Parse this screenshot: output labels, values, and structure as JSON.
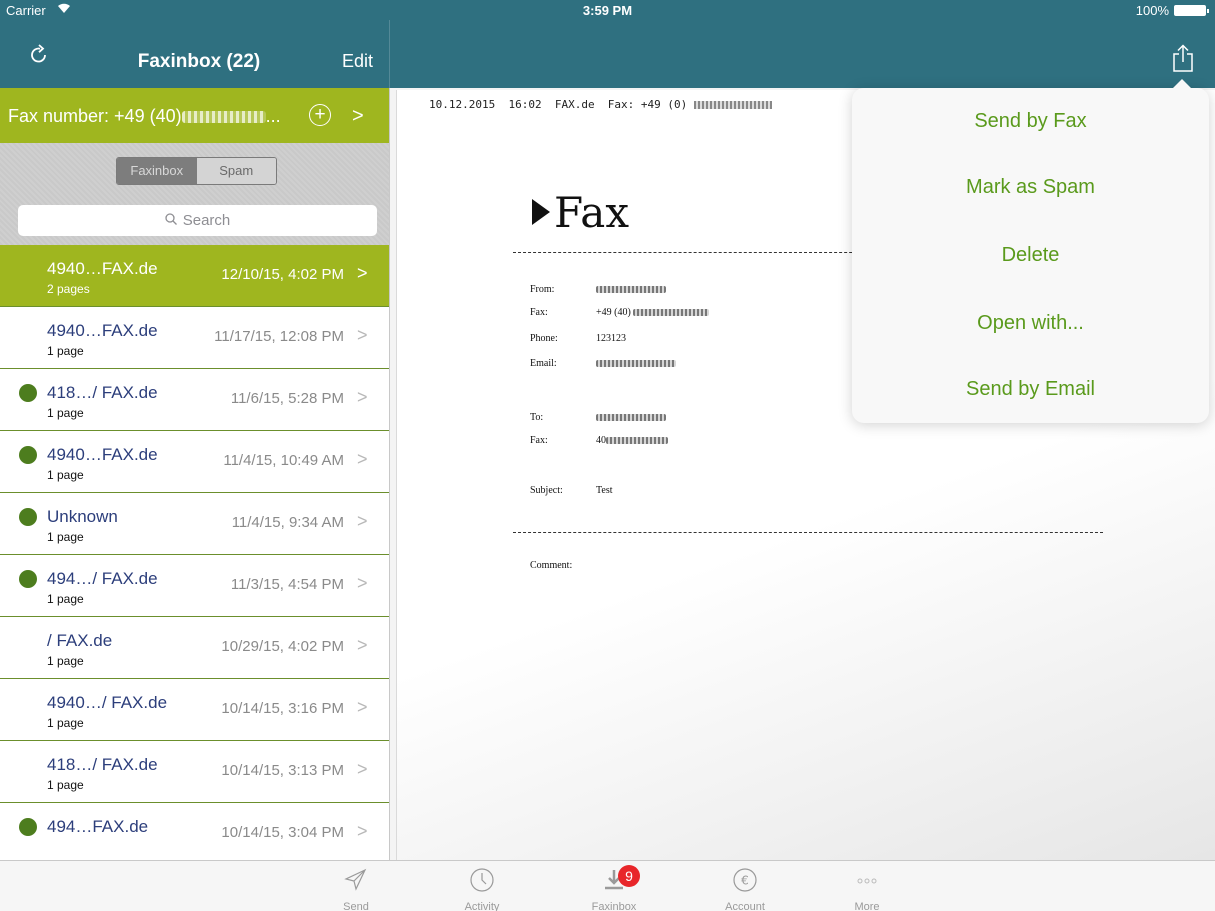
{
  "status_bar": {
    "carrier": "Carrier",
    "time": "3:59 PM",
    "battery": "100%"
  },
  "navbar": {
    "title": "Faxinbox (22)",
    "edit_label": "Edit"
  },
  "fax_number_bar": {
    "label": "Fax number: +49 (40)",
    "suffix": "...",
    "arrow": ">"
  },
  "segments": {
    "active": "Faxinbox",
    "inactive": "Spam"
  },
  "search": {
    "placeholder": "Search"
  },
  "faxes": [
    {
      "name": "4940…FAX.de",
      "pages": "2 pages",
      "date": "12/10/15, 4:02 PM"
    },
    {
      "name": "4940…FAX.de",
      "pages": "1 page",
      "date": "11/17/15, 12:08 PM"
    },
    {
      "name": "418…/ FAX.de",
      "pages": "1 page",
      "date": "11/6/15, 5:28 PM"
    },
    {
      "name": "4940…FAX.de",
      "pages": "1 page",
      "date": "11/4/15, 10:49 AM"
    },
    {
      "name": "Unknown",
      "pages": "1 page",
      "date": "11/4/15, 9:34 AM"
    },
    {
      "name": "494…/ FAX.de",
      "pages": "1 page",
      "date": "11/3/15, 4:54 PM"
    },
    {
      "name": "/ FAX.de",
      "pages": "1 page",
      "date": "10/29/15, 4:02 PM"
    },
    {
      "name": "4940…/ FAX.de",
      "pages": "1 page",
      "date": "10/14/15, 3:16 PM"
    },
    {
      "name": "418…/ FAX.de",
      "pages": "1 page",
      "date": "10/14/15, 3:13 PM"
    },
    {
      "name": "494…FAX.de",
      "pages": "",
      "date": "10/14/15, 3:04 PM"
    }
  ],
  "document": {
    "header": "10.12.2015  16:02  FAX.de  Fax: +49 (0)",
    "logo_text": "Fax",
    "fields": {
      "from_label": "From:",
      "fax_label": "Fax:",
      "phone_label": "Phone:",
      "phone_value": "123123",
      "email_label": "Email:",
      "to_label": "To:",
      "to_fax_label": "Fax:",
      "to_fax_prefix": "40",
      "subject_label": "Subject:",
      "subject_value": "Test",
      "comment_label": "Comment:",
      "fax_prefix": "+49 (40)"
    }
  },
  "share_menu": {
    "items": [
      "Send by Fax",
      "Mark as Spam",
      "Delete",
      "Open with...",
      "Send by Email"
    ]
  },
  "tabbar": {
    "tabs": [
      {
        "label": "Send",
        "icon": "paper-plane-icon"
      },
      {
        "label": "Activity",
        "icon": "clock-icon"
      },
      {
        "label": "Faxinbox",
        "icon": "inbox-download-icon",
        "badge": "9"
      },
      {
        "label": "Account",
        "icon": "euro-icon"
      },
      {
        "label": "More",
        "icon": "more-dots-icon"
      }
    ]
  },
  "colors": {
    "nav": "#2f7080",
    "accent_green": "#9fb61f",
    "menu_green": "#5a9a1c",
    "unread_dot": "#4d7d1e",
    "badge": "#e8262a"
  }
}
